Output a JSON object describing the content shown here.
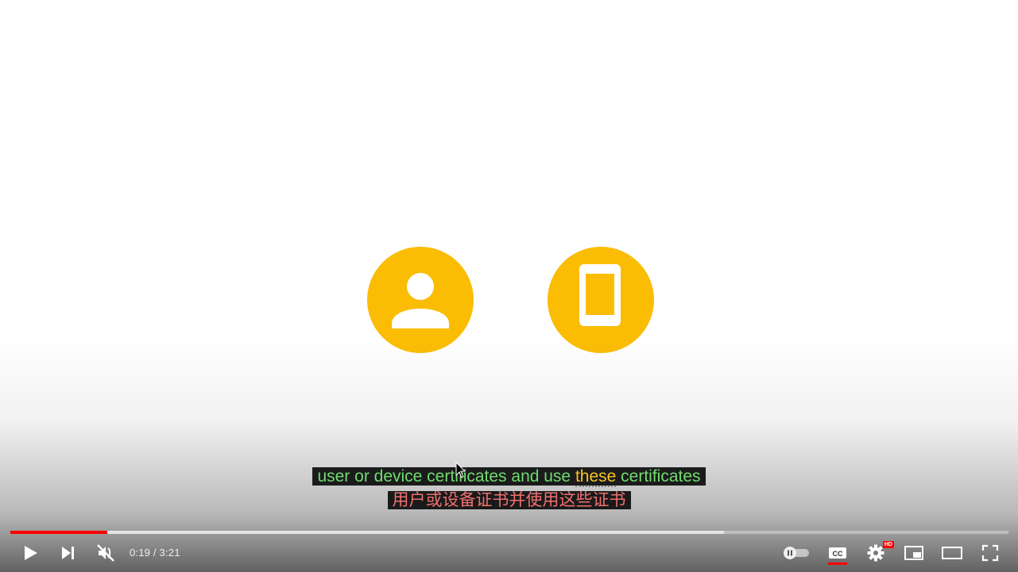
{
  "colors": {
    "accent": "#fbbc04",
    "red": "#ff0000",
    "subtitle_green": "#6fdc6f",
    "subtitle_yellow": "#f7c325",
    "subtitle_red": "#f07070"
  },
  "video": {
    "icons": [
      "person-icon",
      "smartphone-icon"
    ]
  },
  "subtitles": {
    "line1_part1": "user or device certificates and use ",
    "line1_highlight": "these",
    "line1_part2": " certificates",
    "line2": "用户或设备证书并使用这些证书"
  },
  "player": {
    "current_time": "0:19",
    "duration": "3:21",
    "time_display": "0:19 / 3:21",
    "progress_fraction": 0.097,
    "buffered_fraction": 0.715,
    "muted": true,
    "captions_on": true,
    "quality_badge": "HD",
    "controls": [
      "play-icon",
      "next-icon",
      "volume-muted-icon",
      "autoplay-toggle-icon",
      "subtitles-icon",
      "settings-icon",
      "miniplayer-icon",
      "theater-mode-icon",
      "fullscreen-icon"
    ]
  }
}
